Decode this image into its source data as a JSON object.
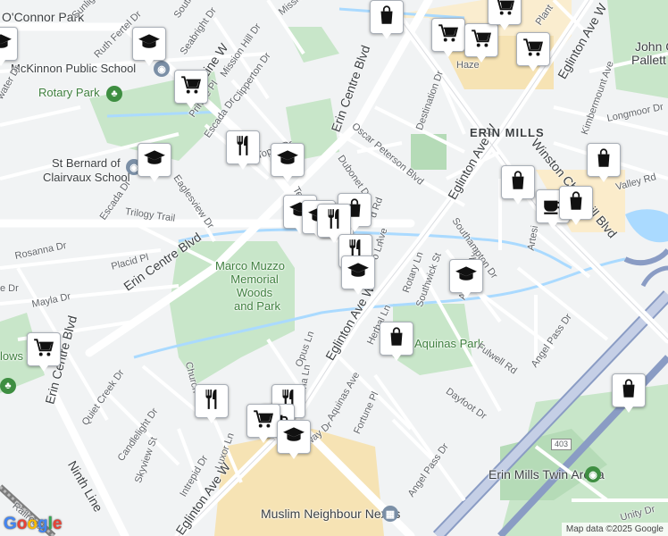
{
  "map": {
    "attribution": "Map data ©2025 Google",
    "logo_letters": [
      "G",
      "o",
      "o",
      "g",
      "l",
      "e"
    ]
  },
  "labels": {
    "oconnor_park": "O'Connor Park",
    "sunlight": "Sunlight",
    "south": "South",
    "mission": "Mission",
    "seabright": "Seabright Dr",
    "mission_hill": "Mission Hill Dr",
    "ruth_fertel": "Ruth Fertel Dr",
    "tenth_line": "Tenth Line W",
    "clipperton": "Clipperton Dr",
    "mckinnon_school": "McKinnon Public School",
    "rotary_park": "Rotary Park",
    "pringle": "Pringle Pl",
    "escada_top": "Escada Dr",
    "escada_left": "Escada Dr",
    "water_dr": "water Dr",
    "st_bernard_1": "St Bernard of",
    "st_bernard_2": "Clairvaux School",
    "toper": "Toper Dr",
    "al": "Al",
    "eaglesview": "Eaglesview Dr",
    "terra": "Ter",
    "trilogy": "Trilogy Trail",
    "rosanna": "Rosanna Dr",
    "placid": "Placid Pl",
    "erin_centre_blvd_mid": "Erin Centre Blvd",
    "erin_centre_blvd_left": "Erin Centre Blvd",
    "erin_centre_blvd_top": "Erin Centre Blvd",
    "mayla": "Mayla Dr",
    "e_dr": "e Dr",
    "marco_1": "Marco Muzzo",
    "marco_2": "Memorial",
    "marco_3": "Woods",
    "marco_4": "and Park",
    "lows": "lows Pa",
    "opus": "Opus Ln",
    "quiet_creek": "Quiet Creek Dr",
    "church": "Church",
    "candlelight": "Candlelight Dr",
    "ninth_line": "Ninth Line",
    "skyview": "Skyview St",
    "intrepid": "Intrepid Dr",
    "luxor": "Luxor Ln",
    "eglinton_bottom": "Eglinton Ave W",
    "eglinton_mid": "Eglinton Ave W",
    "eglinton_east": "Eglinton Ave W",
    "eglinton_ne": "Eglinton Ave W",
    "herbal": "Herbal Ln",
    "aquinas_ave": "Aquinas Ave",
    "aquinas_park": "Aquinas Park",
    "fortune": "Fortune Pl",
    "way_dr": "eway Dr",
    "na_ln": "na Ln",
    "dayfoot": "Dayfoot Dr",
    "angel_pass_left": "Angel Pass Dr",
    "angel_pass_right": "Angel Pass Dr",
    "fulwell": "Fulwell Rd",
    "rotary_ln": "Rotary Ln",
    "southwick": "Southwick St",
    "aquinas_ave_2": "Aquinas Ave",
    "southampton": "Southampton Dr",
    "dubonet": "Dubonet Dr",
    "oscar": "Oscar Peterson Blvd",
    "destination": "Destination Dr",
    "erin_mills": "ERIN MILLS",
    "hazel": "Haze",
    "plant": "Plant",
    "kimbermount": "Kimbermount Ave",
    "longmoor": "Longmoor Dr",
    "winston": "Winston Churchill Blvd",
    "valley": "Valley Rd",
    "artesian": "Artesi",
    "john_1": "John C",
    "john_2": "Pallett P",
    "erin_mills_arena": "Erin Mills Twin Arena",
    "muslim_nexus": "Muslim Neighbour Nexus",
    "unity": "Unity Dr",
    "railroad": "Railroad",
    "hwy_403": "403",
    "ave_frag": "Ave",
    "rd_frag": "d Rd",
    "ln_frag": "o Ln"
  },
  "pins": [
    {
      "name": "shopping-pin-1",
      "icon": "bag"
    },
    {
      "name": "grocery-pin-1",
      "icon": "cart"
    },
    {
      "name": "grocery-pin-2",
      "icon": "cart"
    },
    {
      "name": "grocery-pin-3",
      "icon": "cart"
    },
    {
      "name": "grocery-pin-4",
      "icon": "cart"
    },
    {
      "name": "school-pin-1",
      "icon": "school"
    },
    {
      "name": "school-pin-2",
      "icon": "school"
    },
    {
      "name": "grocery-pin-5",
      "icon": "cart"
    },
    {
      "name": "restaurant-pin-1",
      "icon": "fork"
    },
    {
      "name": "school-pin-3",
      "icon": "school"
    },
    {
      "name": "school-pin-4",
      "icon": "school"
    },
    {
      "name": "school-pin-5",
      "icon": "school"
    },
    {
      "name": "school-pin-6",
      "icon": "school"
    },
    {
      "name": "restaurant-pin-2",
      "icon": "fork"
    },
    {
      "name": "shopping-pin-2",
      "icon": "bag"
    },
    {
      "name": "restaurant-pin-3",
      "icon": "fork"
    },
    {
      "name": "restaurant-pin-4",
      "icon": "fork"
    },
    {
      "name": "school-pin-7",
      "icon": "school"
    },
    {
      "name": "school-pin-8",
      "icon": "school"
    },
    {
      "name": "shopping-pin-3",
      "icon": "bag"
    },
    {
      "name": "shopping-pin-4",
      "icon": "bag"
    },
    {
      "name": "grocery-pin-6",
      "icon": "cart"
    },
    {
      "name": "cafe-pin-1",
      "icon": "cup"
    },
    {
      "name": "shopping-pin-5",
      "icon": "bag"
    },
    {
      "name": "shopping-pin-6",
      "icon": "bag"
    },
    {
      "name": "shopping-pin-7",
      "icon": "bag"
    },
    {
      "name": "restaurant-pin-5",
      "icon": "fork"
    },
    {
      "name": "restaurant-pin-6",
      "icon": "fork"
    },
    {
      "name": "cafe-pin-2",
      "icon": "cup"
    },
    {
      "name": "grocery-pin-7",
      "icon": "cart"
    },
    {
      "name": "school-pin-9",
      "icon": "school"
    }
  ],
  "colors": {
    "park": "#c8e6c9",
    "water": "#aadaff",
    "road": "#ffffff",
    "highway": "#8a9cc4",
    "commercial": "#fbeccb",
    "pin_icon": "#111111"
  }
}
